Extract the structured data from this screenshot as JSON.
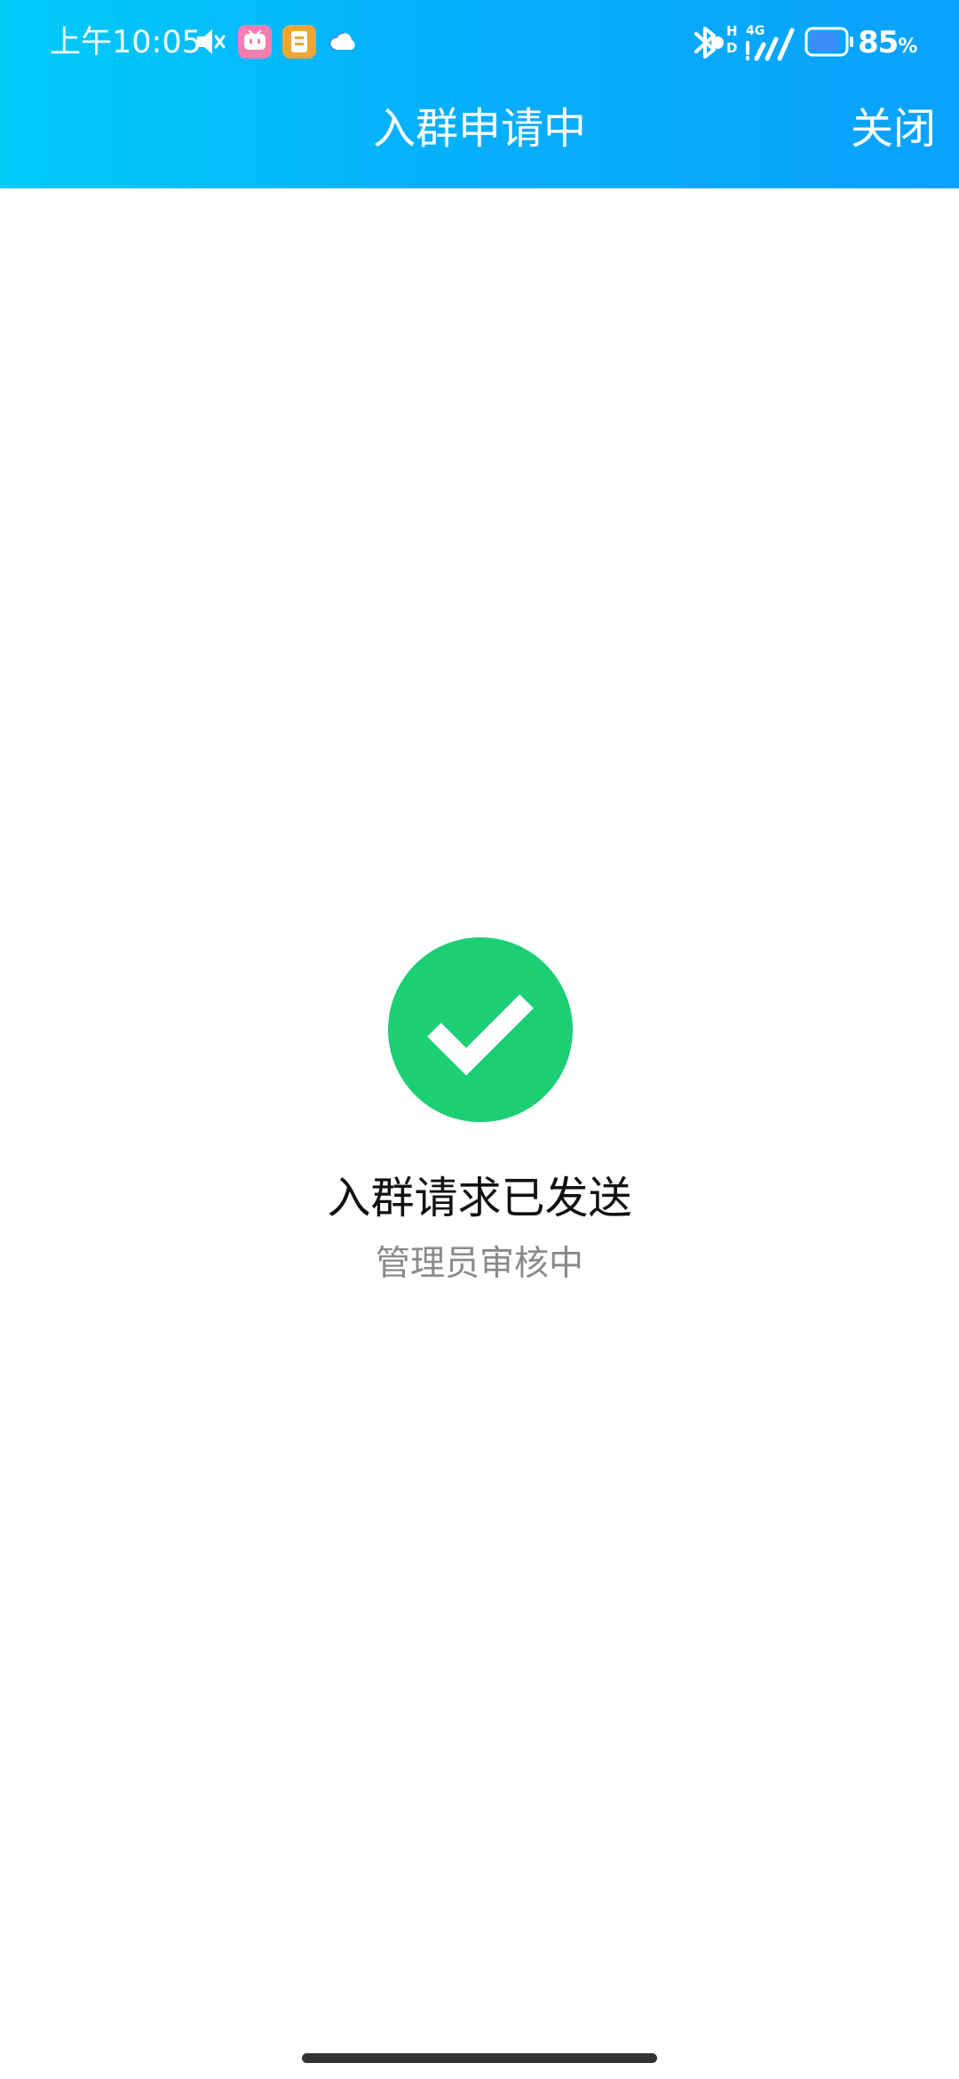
{
  "status_bar": {
    "time": "上午10:05",
    "battery_percent": "85",
    "battery_unit": "%",
    "network": "4G",
    "hd_label_top": "H",
    "hd_label_bottom": "D",
    "battery_level": 0.85,
    "icons": [
      "mute-icon",
      "app-notification-icon",
      "app-notification-icon",
      "cloud-icon",
      "bluetooth-icon",
      "signal-icon",
      "battery-icon"
    ]
  },
  "nav": {
    "title": "入群申请中",
    "close_label": "关闭"
  },
  "result": {
    "icon": "check-circle-icon",
    "title": "入群请求已发送",
    "subtitle": "管理员审核中"
  },
  "colors": {
    "header_gradient_start": "#00ccf8",
    "header_gradient_end": "#0aa2fc",
    "success_green": "#1ccf75",
    "subtitle_gray": "#8a8a8a"
  }
}
